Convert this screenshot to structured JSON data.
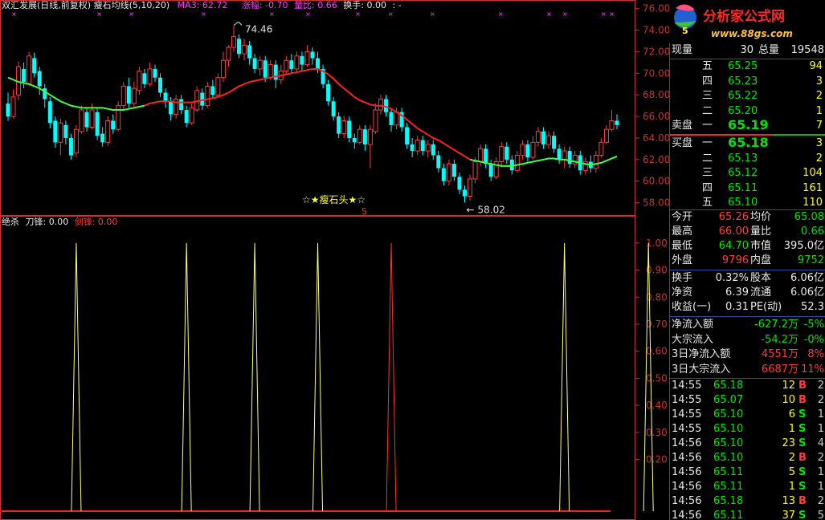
{
  "header": {
    "title": "双汇发展(日线,前复权)",
    "indicator_name": "瘦石均线(5,10,20)",
    "ma3": "MA3: 62.72",
    "change": "涨幅: -0.70",
    "vol_ratio": "量比: 0.66",
    "turnover": "换手: 0.00",
    "extra": ": -"
  },
  "main_chart": {
    "y_ticks": [
      "76.00",
      "74.00",
      "72.00",
      "70.00",
      "68.00",
      "66.00",
      "64.00",
      "62.00",
      "60.00",
      "58.00"
    ],
    "y_range": [
      57.3,
      76.2
    ],
    "high_label": "74.46",
    "low_label": "58.02",
    "signal_text": "☆★瘦石头★☆",
    "signal_mark": "S",
    "candles": [
      [
        67.2,
        66.0,
        68.2,
        65.6
      ],
      [
        66.0,
        67.8,
        68.5,
        65.8
      ],
      [
        68.0,
        70.6,
        71.1,
        67.5
      ],
      [
        70.4,
        69.2,
        71.0,
        68.6
      ],
      [
        69.0,
        71.6,
        72.0,
        68.8
      ],
      [
        71.4,
        70.0,
        71.9,
        69.6
      ],
      [
        70.2,
        68.8,
        70.6,
        68.0
      ],
      [
        68.6,
        67.6,
        69.0,
        66.8
      ],
      [
        67.4,
        65.4,
        67.8,
        64.9
      ],
      [
        65.6,
        63.6,
        66.0,
        63.1
      ],
      [
        63.6,
        65.4,
        65.8,
        62.4
      ],
      [
        65.2,
        64.0,
        65.6,
        63.4
      ],
      [
        64.0,
        62.4,
        64.4,
        62.0
      ],
      [
        62.6,
        64.8,
        65.2,
        62.2
      ],
      [
        64.6,
        66.6,
        67.0,
        64.4
      ],
      [
        66.4,
        65.0,
        66.8,
        64.6
      ],
      [
        65.0,
        66.6,
        67.2,
        64.8
      ],
      [
        66.4,
        64.2,
        66.8,
        63.8
      ],
      [
        64.4,
        63.6,
        65.0,
        63.2
      ],
      [
        63.6,
        65.6,
        66.0,
        63.3
      ],
      [
        65.6,
        64.8,
        66.2,
        64.4
      ],
      [
        64.8,
        67.0,
        67.4,
        64.6
      ],
      [
        67.0,
        68.8,
        69.2,
        66.6
      ],
      [
        68.8,
        67.2,
        69.6,
        66.8
      ],
      [
        67.2,
        68.6,
        69.2,
        66.9
      ],
      [
        68.4,
        70.2,
        70.6,
        68.0
      ],
      [
        70.0,
        69.0,
        70.4,
        68.6
      ],
      [
        69.0,
        70.4,
        71.0,
        68.8
      ],
      [
        70.4,
        69.6,
        70.8,
        69.2
      ],
      [
        69.6,
        68.2,
        70.0,
        67.8
      ],
      [
        68.2,
        67.4,
        68.6,
        66.8
      ],
      [
        67.4,
        66.2,
        67.8,
        65.6
      ],
      [
        66.2,
        67.6,
        68.0,
        65.8
      ],
      [
        67.6,
        66.6,
        68.0,
        66.2
      ],
      [
        66.6,
        65.4,
        67.0,
        65.0
      ],
      [
        65.4,
        66.8,
        67.2,
        65.2
      ],
      [
        66.6,
        68.4,
        68.8,
        66.4
      ],
      [
        68.2,
        67.0,
        68.6,
        66.6
      ],
      [
        67.0,
        68.8,
        69.2,
        66.8
      ],
      [
        68.8,
        68.0,
        69.4,
        67.6
      ],
      [
        68.0,
        69.6,
        70.0,
        67.8
      ],
      [
        69.6,
        71.2,
        72.0,
        69.2
      ],
      [
        71.2,
        72.4,
        72.6,
        70.6
      ],
      [
        72.4,
        73.4,
        74.46,
        72.0
      ],
      [
        73.2,
        71.8,
        73.6,
        71.4
      ],
      [
        71.8,
        72.6,
        73.2,
        71.2
      ],
      [
        72.6,
        71.4,
        73.0,
        70.8
      ],
      [
        71.4,
        70.4,
        71.8,
        70.0
      ],
      [
        70.4,
        71.2,
        71.6,
        69.8
      ],
      [
        71.2,
        69.6,
        71.6,
        69.2
      ],
      [
        69.6,
        70.8,
        71.2,
        69.4
      ],
      [
        70.8,
        69.4,
        71.2,
        68.6
      ],
      [
        69.4,
        70.2,
        70.8,
        69.0
      ],
      [
        70.2,
        71.2,
        71.6,
        69.8
      ],
      [
        71.2,
        70.4,
        71.8,
        70.0
      ],
      [
        70.4,
        71.6,
        72.0,
        70.2
      ],
      [
        71.6,
        70.8,
        72.0,
        70.2
      ],
      [
        70.8,
        72.0,
        72.6,
        70.6
      ],
      [
        72.0,
        71.4,
        72.4,
        70.8
      ],
      [
        71.4,
        70.4,
        72.0,
        70.0
      ],
      [
        70.4,
        69.0,
        70.8,
        68.6
      ],
      [
        69.0,
        67.4,
        69.4,
        67.0
      ],
      [
        67.4,
        66.0,
        67.8,
        65.6
      ],
      [
        66.0,
        64.4,
        66.4,
        64.0
      ],
      [
        64.4,
        65.6,
        66.0,
        64.0
      ],
      [
        65.6,
        64.0,
        66.0,
        63.6
      ],
      [
        64.0,
        63.6,
        64.4,
        63.0
      ],
      [
        63.6,
        64.8,
        65.2,
        63.4
      ],
      [
        64.8,
        63.4,
        65.2,
        62.8
      ],
      [
        63.4,
        64.8,
        65.2,
        61.2
      ],
      [
        64.6,
        66.6,
        67.2,
        64.4
      ],
      [
        66.6,
        67.6,
        68.0,
        66.2
      ],
      [
        67.6,
        66.4,
        68.0,
        66.0
      ],
      [
        66.4,
        65.2,
        66.8,
        64.6
      ],
      [
        65.2,
        66.4,
        66.8,
        64.8
      ],
      [
        66.4,
        65.0,
        66.8,
        64.6
      ],
      [
        65.0,
        63.4,
        65.4,
        63.0
      ],
      [
        63.4,
        62.8,
        64.0,
        62.2
      ],
      [
        62.8,
        63.8,
        64.2,
        62.4
      ],
      [
        63.8,
        62.8,
        64.2,
        62.4
      ],
      [
        62.8,
        63.4,
        63.8,
        62.2
      ],
      [
        63.4,
        62.4,
        63.8,
        62.0
      ],
      [
        62.4,
        61.2,
        62.8,
        60.8
      ],
      [
        61.2,
        60.0,
        61.6,
        59.6
      ],
      [
        60.0,
        61.6,
        62.0,
        59.6
      ],
      [
        61.6,
        60.4,
        62.0,
        60.0
      ],
      [
        60.4,
        59.2,
        60.8,
        58.8
      ],
      [
        59.2,
        58.6,
        59.6,
        58.02
      ],
      [
        58.6,
        60.2,
        60.6,
        58.2
      ],
      [
        60.2,
        61.8,
        62.2,
        59.8
      ],
      [
        61.8,
        63.0,
        63.4,
        61.4
      ],
      [
        63.0,
        61.6,
        63.4,
        61.2
      ],
      [
        61.6,
        60.4,
        62.0,
        60.0
      ],
      [
        60.4,
        61.8,
        62.2,
        60.2
      ],
      [
        61.8,
        63.2,
        63.6,
        61.4
      ],
      [
        63.2,
        62.0,
        63.6,
        61.6
      ],
      [
        62.0,
        61.0,
        62.4,
        60.6
      ],
      [
        61.0,
        62.4,
        62.8,
        60.8
      ],
      [
        62.4,
        63.4,
        63.8,
        62.0
      ],
      [
        63.4,
        62.2,
        63.8,
        61.8
      ],
      [
        62.2,
        63.6,
        64.2,
        62.0
      ],
      [
        63.6,
        64.6,
        65.0,
        63.2
      ],
      [
        64.6,
        63.4,
        65.0,
        63.0
      ],
      [
        63.4,
        64.2,
        64.6,
        63.0
      ],
      [
        64.2,
        63.0,
        64.6,
        62.6
      ],
      [
        63.0,
        62.0,
        63.4,
        61.6
      ],
      [
        62.0,
        62.8,
        63.2,
        61.2
      ],
      [
        62.8,
        61.6,
        63.2,
        61.2
      ],
      [
        61.6,
        62.4,
        62.8,
        61.2
      ],
      [
        62.4,
        61.0,
        62.8,
        60.6
      ],
      [
        61.0,
        61.8,
        62.2,
        60.6
      ],
      [
        61.8,
        61.2,
        62.4,
        60.8
      ],
      [
        61.2,
        62.4,
        62.8,
        60.8
      ],
      [
        62.4,
        63.6,
        64.0,
        62.2
      ],
      [
        63.6,
        64.8,
        65.2,
        63.4
      ],
      [
        64.8,
        65.6,
        66.6,
        64.6
      ],
      [
        65.6,
        65.2,
        66.2,
        64.8
      ]
    ],
    "ma_line": [
      69.6,
      69.4,
      69.2,
      69.1,
      69.0,
      68.8,
      68.6,
      68.3,
      68.0,
      67.7,
      67.4,
      67.2,
      67.0,
      66.9,
      66.8,
      66.8,
      66.8,
      66.8,
      66.8,
      66.7,
      66.6,
      66.6,
      66.6,
      66.7,
      66.8,
      66.9,
      67.0,
      67.2,
      67.3,
      67.4,
      67.4,
      67.4,
      67.3,
      67.3,
      67.3,
      67.3,
      67.4,
      67.5,
      67.6,
      67.7,
      67.8,
      68.0,
      68.2,
      68.5,
      68.8,
      69.0,
      69.2,
      69.3,
      69.4,
      69.5,
      69.6,
      69.7,
      69.8,
      69.9,
      70.0,
      70.1,
      70.2,
      70.3,
      70.4,
      70.4,
      70.2,
      69.9,
      69.5,
      69.0,
      68.6,
      68.2,
      67.8,
      67.5,
      67.3,
      67.1,
      67.0,
      67.0,
      66.9,
      66.7,
      66.4,
      66.1,
      65.7,
      65.3,
      64.9,
      64.6,
      64.3,
      64.0,
      63.8,
      63.5,
      63.2,
      62.9,
      62.6,
      62.3,
      62.0,
      61.9,
      61.8,
      61.7,
      61.6,
      61.5,
      61.4,
      61.4,
      61.4,
      61.5,
      61.6,
      61.7,
      61.8,
      61.9,
      62.0,
      62.1,
      62.1,
      62.0,
      62.0,
      61.9,
      61.8,
      61.7,
      61.6,
      61.5,
      61.6,
      61.7,
      61.9,
      62.1,
      62.3
    ],
    "ma_red_range": [
      26,
      88
    ]
  },
  "sub_chart": {
    "title": "绝杀",
    "label1": "刀锋: 0.00",
    "label2": "剑锋: 0.00",
    "y_ticks": [
      "1.00",
      "0.90",
      "0.80",
      "0.70",
      "0.60",
      "0.50",
      "0.40",
      "0.30",
      "0.20"
    ],
    "y_range": [
      0,
      1.05
    ],
    "peaks": [
      {
        "index": 13,
        "value": 1.0,
        "color": "#ffff80"
      },
      {
        "index": 34,
        "value": 1.0,
        "color": "#ffff80"
      },
      {
        "index": 47,
        "value": 1.0,
        "color": "#ffff80"
      },
      {
        "index": 59,
        "value": 1.0,
        "color": "#ffff80"
      },
      {
        "index": 73,
        "value": 1.0,
        "color": "#ff3030"
      },
      {
        "index": 106,
        "value": 1.0,
        "color": "#ffff80"
      },
      {
        "index": 122,
        "value": 1.0,
        "color": "#ffff80"
      }
    ]
  },
  "logo": {
    "text": "分析家公式网",
    "url_text": "www.88gs.com"
  },
  "panel": {
    "vol_label": "现量",
    "vol_value": "30",
    "total_label": "总量",
    "total_value": "19548",
    "sell": [
      {
        "level": "五",
        "price": "65.25",
        "qty": "94"
      },
      {
        "level": "四",
        "price": "65.23",
        "qty": "3"
      },
      {
        "level": "三",
        "price": "65.22",
        "qty": "2"
      },
      {
        "level": "二",
        "price": "65.20",
        "qty": "1"
      },
      {
        "level": "一",
        "price": "65.19",
        "qty": "7"
      }
    ],
    "sell_label": "卖盘",
    "buy_label": "买盘",
    "buy": [
      {
        "level": "一",
        "price": "65.18",
        "qty": "3"
      },
      {
        "level": "二",
        "price": "65.13",
        "qty": "2"
      },
      {
        "level": "三",
        "price": "65.12",
        "qty": "104"
      },
      {
        "level": "四",
        "price": "65.11",
        "qty": "161"
      },
      {
        "level": "五",
        "price": "65.10",
        "qty": "110"
      }
    ],
    "stats": [
      {
        "l1": "今开",
        "v1": "65.26",
        "c1": "red",
        "l2": "均价",
        "v2": "65.08",
        "c2": "green"
      },
      {
        "l1": "最高",
        "v1": "66.00",
        "c1": "red",
        "l2": "量比",
        "v2": "0.66",
        "c2": "green"
      },
      {
        "l1": "最低",
        "v1": "64.70",
        "c1": "green",
        "l2": "市值",
        "v2": "395.0亿",
        "c2": "white"
      },
      {
        "l1": "外盘",
        "v1": "9796",
        "c1": "red",
        "l2": "内盘",
        "v2": "9752",
        "c2": "green"
      }
    ],
    "stats2": [
      {
        "l1": "换手",
        "v1": "0.32%",
        "c1": "white",
        "l2": "股本",
        "v2": "6.06亿",
        "c2": "white"
      },
      {
        "l1": "净资",
        "v1": "6.39",
        "c1": "white",
        "l2": "流通",
        "v2": "6.06亿",
        "c2": "white"
      },
      {
        "l1": "收益(一)",
        "v1": "0.31",
        "c1": "white",
        "l2": "PE(动)",
        "v2": "52.3",
        "c2": "white"
      }
    ],
    "flows": [
      {
        "label": "净流入额",
        "value": "-627.2万",
        "pct": "-5%",
        "color": "green"
      },
      {
        "label": "大宗流入",
        "value": "-54.2万",
        "pct": "-0%",
        "color": "green"
      },
      {
        "label": "3日净流入额",
        "value": "4551万",
        "pct": "8%",
        "color": "red"
      },
      {
        "label": "3日大宗流入",
        "value": "6687万",
        "pct": "11%",
        "color": "red"
      }
    ],
    "ticks": [
      {
        "time": "14:55",
        "price": "65.18",
        "vol": "12",
        "side": "B",
        "n": "2"
      },
      {
        "time": "14:55",
        "price": "65.07",
        "vol": "10",
        "side": "B",
        "n": "2"
      },
      {
        "time": "14:55",
        "price": "65.10",
        "vol": "6",
        "side": "S",
        "n": "1"
      },
      {
        "time": "14:55",
        "price": "65.10",
        "vol": "1",
        "side": "S",
        "n": "1"
      },
      {
        "time": "14:56",
        "price": "65.10",
        "vol": "23",
        "side": "S",
        "n": "4"
      },
      {
        "time": "14:56",
        "price": "65.10",
        "vol": "2",
        "side": "B",
        "n": "2"
      },
      {
        "time": "14:56",
        "price": "65.11",
        "vol": "5",
        "side": "S",
        "n": "1"
      },
      {
        "time": "14:56",
        "price": "65.11",
        "vol": "1",
        "side": "S",
        "n": "1"
      },
      {
        "time": "14:56",
        "price": "65.18",
        "vol": "13",
        "side": "B",
        "n": "2"
      },
      {
        "time": "14:56",
        "price": "65.11",
        "vol": "37",
        "side": "S",
        "n": "5"
      }
    ]
  }
}
